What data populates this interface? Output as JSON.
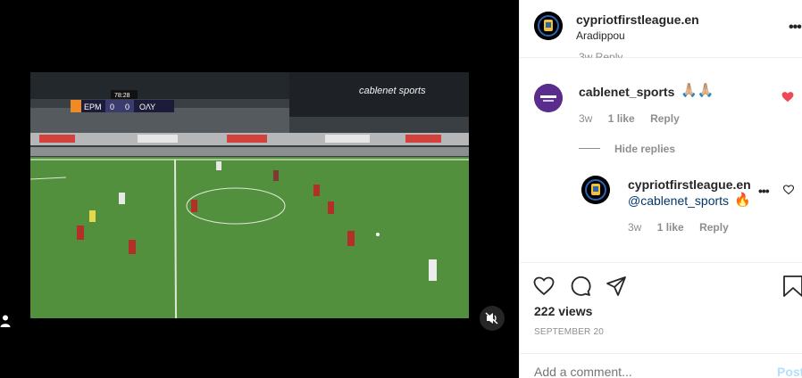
{
  "header": {
    "account": "cypriotfirstleague.en",
    "location": "Aradippou",
    "more": "•••"
  },
  "video": {
    "score_home_team": "ΕΡΜ",
    "score_home": "0",
    "score_away": "0",
    "score_away_team": "ΟΛΥ",
    "clock": "78:28",
    "broadcaster": "cablenet sports"
  },
  "comments": {
    "truncated": "3w   Reply",
    "first": {
      "user": "cablenet_sports",
      "text": "🙏🏼🙏🏼",
      "time": "3w",
      "likes": "1 like",
      "reply": "Reply"
    },
    "hide_replies": "Hide replies",
    "reply": {
      "user": "cypriotfirstleague.en",
      "mention": "@cablenet_sports",
      "emoji": "🔥",
      "more": "•••",
      "time": "3w",
      "likes": "1 like",
      "reply": "Reply"
    }
  },
  "stats": {
    "views": "222 views",
    "date": "SEPTEMBER 20"
  },
  "composer": {
    "placeholder": "Add a comment...",
    "post": "Post"
  },
  "colors": {
    "liked_heart": "#ed4956",
    "mention": "#00376b",
    "post_disabled": "#b2dffc"
  }
}
